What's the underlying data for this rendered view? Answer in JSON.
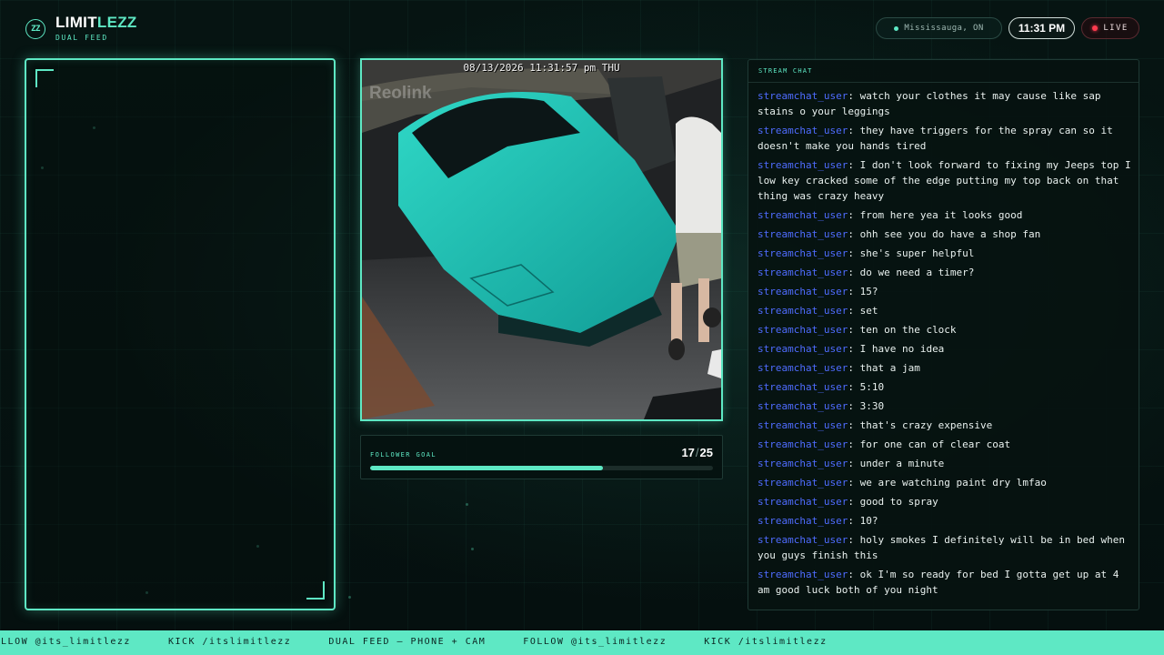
{
  "brand": {
    "badge": "ZZ",
    "name_part1": "LIMIT",
    "name_part2": "LEZZ",
    "subtitle": "DUAL FEED"
  },
  "status": {
    "location": "Mississauga, ON",
    "time": "11:31 PM",
    "live_label": "LIVE",
    "live_color": "#ff3b4f"
  },
  "camera": {
    "timestamp": "08/13/2026 11:31:57 pm THU",
    "watermark": "Reolink"
  },
  "follower_goal": {
    "label": "FOLLOWER GOAL",
    "current": "17",
    "target": "25",
    "progress_fraction": 0.68
  },
  "chat": {
    "title": "STREAM CHAT",
    "messages": [
      {
        "user": "streamchat_user",
        "text": "watch your clothes it may cause like sap stains o your leggings"
      },
      {
        "user": "streamchat_user",
        "text": "they have triggers for the spray can so it doesn't make you hands tired"
      },
      {
        "user": "streamchat_user",
        "text": "I don't look forward to fixing my Jeeps top I low key cracked some of the edge putting my top back on that thing was crazy heavy"
      },
      {
        "user": "streamchat_user",
        "text": "from here yea it looks good"
      },
      {
        "user": "streamchat_user",
        "text": "ohh see you do have a shop fan"
      },
      {
        "user": "streamchat_user",
        "text": "she's super helpful"
      },
      {
        "user": "streamchat_user",
        "text": "do we need a timer?"
      },
      {
        "user": "streamchat_user",
        "text": "15?"
      },
      {
        "user": "streamchat_user",
        "text": "set"
      },
      {
        "user": "streamchat_user",
        "text": "ten on the clock"
      },
      {
        "user": "streamchat_user",
        "text": "I have no idea"
      },
      {
        "user": "streamchat_user",
        "text": "that a jam"
      },
      {
        "user": "streamchat_user",
        "text": "5:10"
      },
      {
        "user": "streamchat_user",
        "text": "3:30"
      },
      {
        "user": "streamchat_user",
        "text": "that's crazy expensive"
      },
      {
        "user": "streamchat_user",
        "text": "for one can of clear coat"
      },
      {
        "user": "streamchat_user",
        "text": "under a minute"
      },
      {
        "user": "streamchat_user",
        "text": "we are watching paint dry lmfao"
      },
      {
        "user": "streamchat_user",
        "text": "good to spray"
      },
      {
        "user": "streamchat_user",
        "text": "10?"
      },
      {
        "user": "streamchat_user",
        "text": "holy smokes I definitely will be in bed when you guys finish this"
      },
      {
        "user": "streamchat_user",
        "text": "ok I'm so ready for bed I gotta get up at 4 am good luck both of you night"
      }
    ]
  },
  "ticker": {
    "items": [
      "FOLLOW @its_limitlezz",
      "KICK /itslimitlezz",
      "DUAL FEED — PHONE + CAM",
      "FOLLOW @its_limitlezz",
      "KICK /itslimitlezz"
    ]
  },
  "colors": {
    "accent": "#5ee8c4",
    "background": "#061412",
    "chat_username": "#4f6cff"
  }
}
